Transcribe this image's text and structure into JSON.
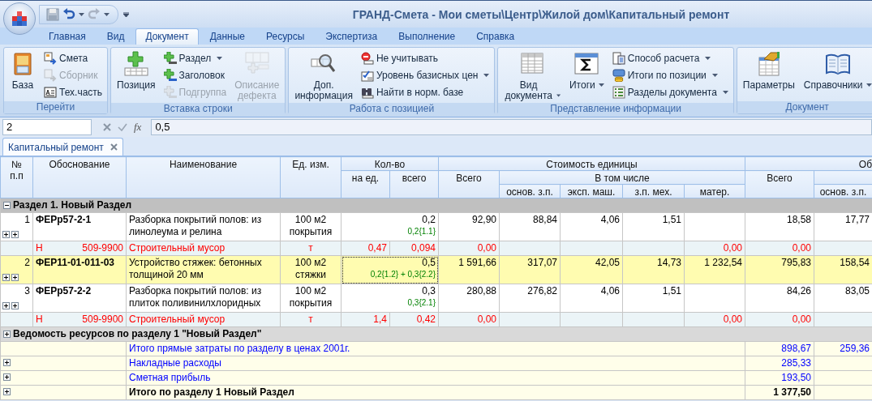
{
  "window": {
    "title": "ГРАНД-Смета - Мои сметы\\Центр\\Жилой дом\\Капитальный ремонт"
  },
  "tabs": [
    {
      "label": "Главная",
      "selected": false
    },
    {
      "label": "Вид",
      "selected": false
    },
    {
      "label": "Документ",
      "selected": true
    },
    {
      "label": "Данные",
      "selected": false
    },
    {
      "label": "Ресурсы",
      "selected": false
    },
    {
      "label": "Экспертиза",
      "selected": false
    },
    {
      "label": "Выполнение",
      "selected": false
    },
    {
      "label": "Справка",
      "selected": false
    }
  ],
  "ribbon": {
    "groups": [
      {
        "title": "Перейти",
        "items": [
          {
            "label": "База",
            "kind": "large",
            "disabled": false,
            "dropdown": false
          },
          {
            "label": "Смета",
            "kind": "small",
            "disabled": false,
            "dropdown": false
          },
          {
            "label": "Сборник",
            "kind": "small",
            "disabled": true,
            "dropdown": false
          },
          {
            "label": "Тех.часть",
            "kind": "small",
            "disabled": false,
            "dropdown": false
          }
        ]
      },
      {
        "title": "Вставка строки",
        "items": [
          {
            "label": "Позиция",
            "kind": "large",
            "disabled": false,
            "dropdown": false
          },
          {
            "label": "Раздел",
            "kind": "small",
            "disabled": false,
            "dropdown": true
          },
          {
            "label": "Заголовок",
            "kind": "small",
            "disabled": false,
            "dropdown": false
          },
          {
            "label": "Подгруппа",
            "kind": "small",
            "disabled": true,
            "dropdown": false
          },
          {
            "label": "Описание дефекта",
            "kind": "large",
            "disabled": true,
            "dropdown": false
          }
        ]
      },
      {
        "title": "Работа с позицией",
        "items": [
          {
            "label": "Доп. информация",
            "kind": "large",
            "disabled": false,
            "dropdown": false
          },
          {
            "label": "Не учитывать",
            "kind": "small",
            "disabled": false,
            "dropdown": false
          },
          {
            "label": "Уровень базисных цен",
            "kind": "small",
            "disabled": false,
            "dropdown": true
          },
          {
            "label": "Найти в норм. базе",
            "kind": "small",
            "disabled": false,
            "dropdown": false
          }
        ]
      },
      {
        "title": "Представление информации",
        "items": [
          {
            "label": "Вид документа",
            "kind": "large",
            "disabled": false,
            "dropdown": true
          },
          {
            "label": "Итоги",
            "kind": "large",
            "disabled": false,
            "dropdown": true
          },
          {
            "label": "Способ расчета",
            "kind": "small",
            "disabled": false,
            "dropdown": true
          },
          {
            "label": "Итоги по позиции",
            "kind": "small",
            "disabled": false,
            "dropdown": true
          },
          {
            "label": "Разделы документа",
            "kind": "small",
            "disabled": false,
            "dropdown": true
          }
        ]
      },
      {
        "title": "Документ",
        "items": [
          {
            "label": "Параметры",
            "kind": "large",
            "disabled": false,
            "dropdown": false
          },
          {
            "label": "Справочники",
            "kind": "large",
            "disabled": false,
            "dropdown": true
          }
        ]
      }
    ]
  },
  "formula_bar": {
    "cell": "2",
    "function_symbol": "fx",
    "value": "0,5"
  },
  "document_tabs": [
    {
      "label": "Капитальный ремонт",
      "selected": true
    }
  ],
  "table": {
    "header": {
      "number": "№\nп.п",
      "basis": "Обоснование",
      "name": "Наименование",
      "unit": "Ед. изм.",
      "quantity": {
        "label": "Кол-во",
        "per_unit": "на ед.",
        "total": "всего"
      },
      "unit_cost": {
        "label": "Стоимость единицы",
        "total": "Всего",
        "including": "В том числе",
        "base_wage": "основ. з.п.",
        "machines": "эксп. маш.",
        "mech_wage": "з.п. мех.",
        "materials": "матер."
      },
      "column_12": {
        "label": "Об",
        "total": "Всего",
        "base_wage": "основ. з.п."
      }
    },
    "rows": [
      {
        "kind": "section",
        "label": "Раздел 1. Новый Раздел",
        "expanded": true,
        "selected": false
      },
      {
        "kind": "position",
        "number": "1",
        "basis": "ФЕРр57-2-1",
        "name": "Разборка покрытий полов: из линолеума и релина",
        "unit": "100 м2 покрытия",
        "total": "0,2",
        "formula": "0,2{1.1}",
        "values": {
          "total": "92,90",
          "base_wage": "88,84",
          "machines": "4,06",
          "mech_wage": "1,51",
          "sum_total": "18,58",
          "sum_base_wage": "17,77"
        },
        "selected": false
      },
      {
        "kind": "resource",
        "resource_type": "Н",
        "code": "509-9900",
        "name": "Строительный мусор",
        "unit": "т",
        "per_unit": "0,47",
        "total": "0,094",
        "values": {
          "total": "0,00",
          "materials": "0,00",
          "sum_total": "0,00"
        },
        "selected": false
      },
      {
        "kind": "position",
        "number": "2",
        "basis": "ФЕР11-01-011-03",
        "name": "Устройство стяжек: бетонных толщиной 20 мм",
        "unit": "100 м2 стяжки",
        "total": "0,5",
        "formula": "0,2{1.2} + 0,3{2.2}",
        "values": {
          "total": "1 591,66",
          "base_wage": "317,07",
          "machines": "42,05",
          "mech_wage": "14,73",
          "materials": "1 232,54",
          "sum_total": "795,83",
          "sum_base_wage": "158,54"
        },
        "selected": true
      },
      {
        "kind": "position",
        "number": "3",
        "basis": "ФЕРр57-2-2",
        "name": "Разборка покрытий полов: из плиток поливинилхлоридных",
        "unit": "100 м2 покрытия",
        "total": "0,3",
        "formula": "0,3{2.1}",
        "values": {
          "total": "280,88",
          "base_wage": "276,82",
          "machines": "4,06",
          "mech_wage": "1,51",
          "sum_total": "84,26",
          "sum_base_wage": "83,05"
        },
        "selected": false
      },
      {
        "kind": "resource",
        "resource_type": "Н",
        "code": "509-9900",
        "name": "Строительный мусор",
        "unit": "т",
        "per_unit": "1,4",
        "total": "0,42",
        "values": {
          "total": "0,00",
          "materials": "0,00",
          "sum_total": "0,00"
        },
        "selected": false
      },
      {
        "kind": "sheet",
        "label": "Ведомость ресурсов по разделу 1 \"Новый Раздел\"",
        "expanded": false,
        "selected": false
      },
      {
        "kind": "total",
        "label": "Итого прямые затраты по разделу в ценах 2001г.",
        "expandable": false,
        "values": {
          "sum_total": "898,67",
          "sum_base_wage": "259,36"
        },
        "selected": false
      },
      {
        "kind": "total",
        "label": "Накладные расходы",
        "expandable": true,
        "values": {
          "sum_total": "285,33"
        },
        "selected": false
      },
      {
        "kind": "total",
        "label": "Сметная прибыль",
        "expandable": true,
        "values": {
          "sum_total": "193,50"
        },
        "selected": false
      },
      {
        "kind": "grand_total",
        "label": "Итого по разделу 1 Новый Раздел",
        "expandable": true,
        "values": {
          "sum_total": "1 377,50"
        },
        "selected": false
      }
    ]
  }
}
